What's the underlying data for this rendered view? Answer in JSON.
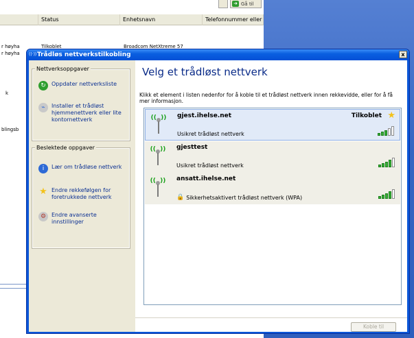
{
  "background_window": {
    "columns": [
      "",
      "Status",
      "Enhetsnavn",
      "Telefonnummer eller ve"
    ],
    "row_fragments": [
      "r høyha",
      "r høyha",
      "k",
      "blingsb"
    ],
    "status_value": "Tilkoblet",
    "device_value": "Broadcom NetXtreme 57",
    "go_label": "Gå til"
  },
  "dialog": {
    "title": "Trådløs nettverkstilkobling",
    "close_label": "x",
    "heading": "Velg et trådløst nettverk",
    "intro": "Klikk et element i listen nedenfor for å koble til et trådløst nettverk innen rekkevidde, eller for å få mer informasjon.",
    "connect_button": "Koble til",
    "task_groups": [
      {
        "title": "Nettverksoppgaver",
        "items": [
          {
            "label": "Oppdater nettverksliste",
            "icon": "refresh-icon"
          },
          {
            "label": "Installer et trådløst hjemmenettverk eller lite kontornettverk",
            "icon": "network-wizard-icon"
          }
        ]
      },
      {
        "title": "Beslektede oppgaver",
        "items": [
          {
            "label": "Lær om trådløse nettverk",
            "icon": "info-icon"
          },
          {
            "label": "Endre rekkefølgen for foretrukkede nettverk",
            "icon": "star-icon"
          },
          {
            "label": "Endre avanserte innstillinger",
            "icon": "settings-icon"
          }
        ]
      }
    ],
    "networks": [
      {
        "name": "gjest.ihelse.net",
        "security": "Usikret trådløst nettverk",
        "status": "Tilkoblet",
        "signal_bars": 3,
        "selected": true,
        "secured": false
      },
      {
        "name": "gjesttest",
        "security": "Usikret trådløst nettverk",
        "status": "",
        "signal_bars": 4,
        "selected": false,
        "secured": false
      },
      {
        "name": "ansatt.ihelse.net",
        "security": "Sikkerhetsaktivert trådløst nettverk (WPA)",
        "status": "",
        "signal_bars": 4,
        "selected": false,
        "secured": true
      }
    ]
  }
}
